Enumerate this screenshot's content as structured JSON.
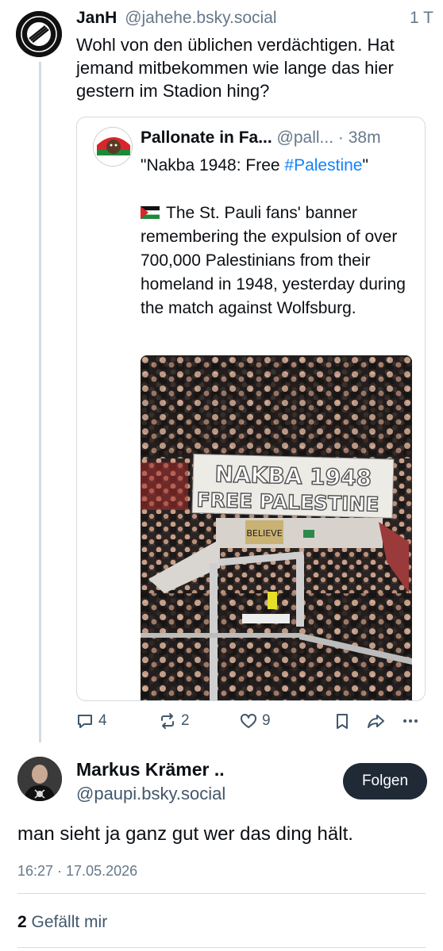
{
  "post1": {
    "display_name": "JanH",
    "handle": "@jahehe.bsky.social",
    "time": "1 T",
    "text": "Wohl von den üblichen verdächtigen. Hat jemand mitbekommen wie lange das hier gestern im Stadion hing?",
    "quote": {
      "display_name": "Pallonate in Fa...",
      "handle": "@pall...",
      "time": "· 38m",
      "line1_prefix": "\"Nakba 1948: Free ",
      "hashtag": "#Palestine",
      "line1_suffix": "\"",
      "body": "The St. Pauli fans' banner remembering the expulsion of over 700,000 Palestinians from their homeland in 1948, yesterday during the match against Wolfsburg.",
      "image": {
        "banner_line1": "NAKBA 1948",
        "banner_line2": "FREE PALESTINE",
        "sign": "BELIEVE"
      }
    },
    "actions": {
      "replies": "4",
      "reposts": "2",
      "likes": "9"
    }
  },
  "post2": {
    "display_name": "Markus Krämer ..",
    "handle": "@paupi.bsky.social",
    "follow_label": "Folgen",
    "text": "man sieht ja ganz gut wer das ding hält.",
    "date": "16:27 · 17.05.2026",
    "likes_count": "2",
    "likes_label": "Gefällt mir"
  },
  "colors": {
    "accent": "#1083fe",
    "muted": "#66788a",
    "border": "#d4dbe2",
    "follow_bg": "#1f2a36"
  }
}
